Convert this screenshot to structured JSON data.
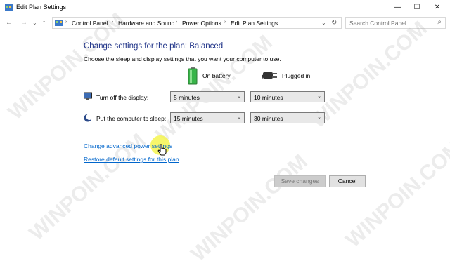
{
  "window": {
    "title": "Edit Plan Settings",
    "icon": "control-panel-icon",
    "minimize_glyph": "—",
    "maximize_glyph": "☐",
    "close_glyph": "✕"
  },
  "navigation": {
    "back_glyph": "←",
    "forward_glyph": "→",
    "recent_glyph": "⌄",
    "up_glyph": "↑",
    "breadcrumbs": [
      "Control Panel",
      "Hardware and Sound",
      "Power Options",
      "Edit Plan Settings"
    ],
    "dropdown_glyph": "⌄",
    "refresh_glyph": "↻",
    "search_placeholder": "Search Control Panel",
    "search_glyph": "⌕"
  },
  "content": {
    "heading": "Change settings for the plan: Balanced",
    "subtitle": "Choose the sleep and display settings that you want your computer to use.",
    "columns": {
      "battery": "On battery",
      "plugged": "Plugged in"
    },
    "rows": [
      {
        "label": "Turn off the display:",
        "battery_value": "5 minutes",
        "plugged_value": "10 minutes"
      },
      {
        "label": "Put the computer to sleep:",
        "battery_value": "15 minutes",
        "plugged_value": "30 minutes"
      }
    ],
    "dropdown_arrow": "⌄",
    "links": {
      "advanced": "Change advanced power settings",
      "restore": "Restore default settings for this plan"
    },
    "buttons": {
      "save": "Save changes",
      "cancel": "Cancel"
    }
  },
  "watermark": "WINPOIN.COM",
  "colors": {
    "heading": "#1e3287",
    "link": "#0066cc",
    "battery_green": "#39b54a"
  }
}
